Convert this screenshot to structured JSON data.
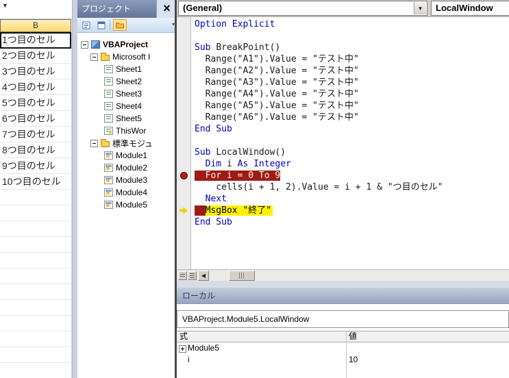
{
  "icons": {
    "name_box_arrow": "▼",
    "close": "×",
    "combo_arrow": "▼",
    "scroll_left": "◀",
    "toolbar_overflow": "▾"
  },
  "colors": {
    "breakpoint_bg": "#9E1B16",
    "current_line_bg": "#FFF200",
    "keyword": "#0000C0",
    "excel_header_fill": "#FFD96E"
  },
  "excel": {
    "column_header": "B",
    "rows": [
      "1つ目のセル",
      "2つ目のセル",
      "3つ目のセル",
      "4つ目のセル",
      "5つ目のセル",
      "6つ目のセル",
      "7つ目のセル",
      "8つ目のセル",
      "9つ目のセル",
      "10つ目のセル"
    ]
  },
  "project_explorer": {
    "title": "プロジェクト",
    "toolbar_icons": [
      "view-code",
      "view-object",
      "toggle-folders"
    ],
    "root": {
      "label": "VBAProject"
    },
    "groups": [
      {
        "label": "Microsoft I",
        "items": [
          {
            "label": "Sheet1",
            "icon": "sheet"
          },
          {
            "label": "Sheet2",
            "icon": "sheet"
          },
          {
            "label": "Sheet3",
            "icon": "sheet"
          },
          {
            "label": "Sheet4",
            "icon": "sheet"
          },
          {
            "label": "Sheet5",
            "icon": "sheet"
          },
          {
            "label": "ThisWor",
            "icon": "workbook"
          }
        ]
      },
      {
        "label": "標準モジュ",
        "items": [
          {
            "label": "Module1",
            "icon": "module"
          },
          {
            "label": "Module2",
            "icon": "module"
          },
          {
            "label": "Module3",
            "icon": "module"
          },
          {
            "label": "Module4",
            "icon": "module"
          },
          {
            "label": "Module5",
            "icon": "module"
          }
        ]
      }
    ]
  },
  "code_window": {
    "object_dropdown": "(General)",
    "procedure_dropdown": "LocalWindow",
    "lines": [
      {
        "m": "",
        "s": [
          {
            "t": "Option Explicit",
            "c": "kw"
          }
        ]
      },
      {
        "m": "",
        "s": []
      },
      {
        "m": "",
        "s": [
          {
            "t": "Sub ",
            "c": "kw"
          },
          {
            "t": "BreakPoint()",
            "c": "pl"
          }
        ]
      },
      {
        "m": "",
        "s": [
          {
            "t": "  Range(\"A1\").Value = \"テスト中\"",
            "c": "pl"
          }
        ]
      },
      {
        "m": "",
        "s": [
          {
            "t": "  Range(\"A2\").Value = \"テスト中\"",
            "c": "pl"
          }
        ]
      },
      {
        "m": "",
        "s": [
          {
            "t": "  Range(\"A3\").Value = \"テスト中\"",
            "c": "pl"
          }
        ]
      },
      {
        "m": "",
        "s": [
          {
            "t": "  Range(\"A4\").Value = \"テスト中\"",
            "c": "pl"
          }
        ]
      },
      {
        "m": "",
        "s": [
          {
            "t": "  Range(\"A5\").Value = \"テスト中\"",
            "c": "pl"
          }
        ]
      },
      {
        "m": "",
        "s": [
          {
            "t": "  Range(\"A6\").Value = \"テスト中\"",
            "c": "pl"
          }
        ]
      },
      {
        "m": "",
        "s": [
          {
            "t": "End Sub",
            "c": "kw"
          }
        ]
      },
      {
        "m": "",
        "s": []
      },
      {
        "m": "",
        "s": [
          {
            "t": "Sub ",
            "c": "kw"
          },
          {
            "t": "LocalWindow()",
            "c": "pl"
          }
        ]
      },
      {
        "m": "",
        "s": [
          {
            "t": "  ",
            "c": "pl"
          },
          {
            "t": "Dim",
            "c": "kw"
          },
          {
            "t": " i ",
            "c": "pl"
          },
          {
            "t": "As",
            "c": "kw"
          },
          {
            "t": " ",
            "c": "pl"
          },
          {
            "t": "Integer",
            "c": "kw"
          }
        ]
      },
      {
        "m": "bp",
        "s": [
          {
            "t": "  For i = 0 To 9",
            "c": "bp"
          }
        ]
      },
      {
        "m": "",
        "s": [
          {
            "t": "    cells(i + 1, 2).Value = i + 1 & \"つ目のセル\"",
            "c": "pl"
          }
        ]
      },
      {
        "m": "",
        "s": [
          {
            "t": "  ",
            "c": "pl"
          },
          {
            "t": "Next",
            "c": "kw"
          }
        ]
      },
      {
        "m": "cur",
        "s": [
          {
            "t": "  ",
            "c": "bp"
          },
          {
            "t": "MsgBox \"終了\"",
            "c": "cur"
          }
        ]
      },
      {
        "m": "",
        "s": [
          {
            "t": "End Sub",
            "c": "kw"
          }
        ]
      }
    ]
  },
  "locals_window": {
    "title": "ローカル",
    "context": "VBAProject.Module5.LocalWindow",
    "columns": [
      "式",
      "値"
    ],
    "rows": [
      {
        "expandable": true,
        "expression": "Module5",
        "value": ""
      },
      {
        "expandable": false,
        "expression": "i",
        "value": "10"
      }
    ]
  }
}
